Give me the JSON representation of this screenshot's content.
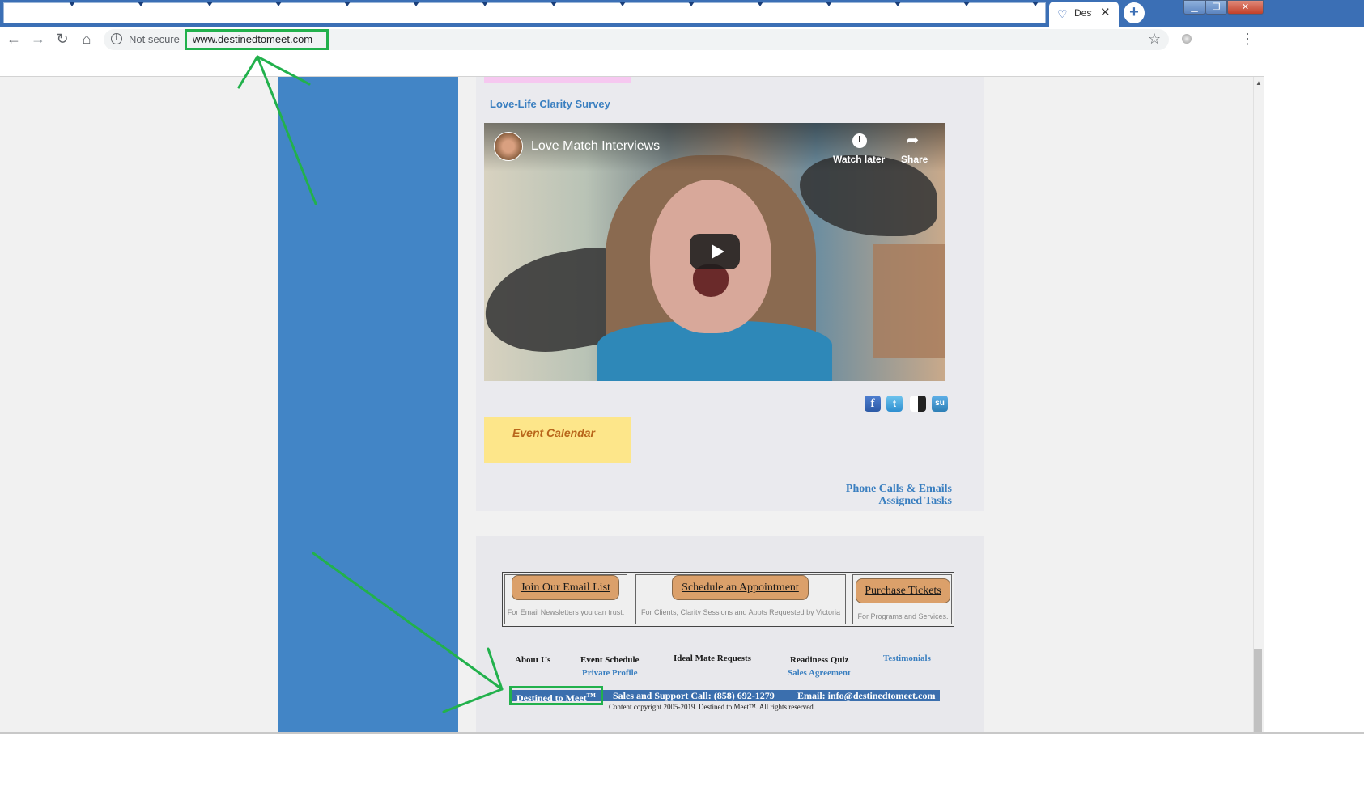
{
  "browser": {
    "tab_title": "Desti",
    "tab_close": "✕",
    "new_tab": "+",
    "not_secure": "Not secure",
    "url": "www.destinedtomeet.com",
    "window_buttons": {
      "minimize": "▁",
      "maximize": "❐",
      "close": "✕"
    }
  },
  "content": {
    "survey_link": "Love-Life Clarity Survey",
    "video": {
      "title": "Love Match Interviews",
      "watch_later": "Watch later",
      "share": "Share"
    },
    "social": {
      "facebook": "f",
      "twitter": "t",
      "stumbleupon": "su"
    },
    "event_calendar": "Event Calendar",
    "phone_link_line1": "Phone Calls & Emails",
    "phone_link_line2": "Assigned Tasks"
  },
  "footer": {
    "buttons": [
      {
        "label": "Join Our Email List",
        "note": "For Email Newsletters you can trust."
      },
      {
        "label": "Schedule an Appointment",
        "note": "For Clients, Clarity Sessions and Appts Requested by Victoria"
      },
      {
        "label": "Purchase Tickets",
        "note": "For Programs and Services."
      }
    ],
    "links": {
      "about": "About Us",
      "event_schedule": "Event Schedule",
      "private_profile": "Private Profile",
      "ideal_mate": "Ideal Mate Requests",
      "readiness_quiz": "Readiness Quiz",
      "sales_agreement": "Sales Agreement",
      "testimonials": "Testimonials"
    },
    "brand": "Destined to Meet",
    "brand_tm": "TM",
    "sales_call": "Sales and Support Call: (858) 692-1279",
    "email": "Email: info@destinedtomeet.com",
    "copyright": "Content copyright 2005-2019.   Destined to Meet™.   All rights reserved."
  },
  "colors": {
    "annotation_green": "#22b14c",
    "sidebar_blue": "#4285c6",
    "link_blue": "#3a7fc0",
    "button_tan": "#dba06a",
    "event_yellow": "#fde68a"
  }
}
